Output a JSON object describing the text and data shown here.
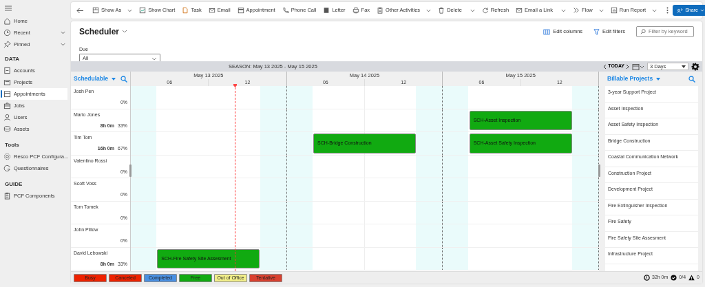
{
  "sidebar": {
    "items": [
      {
        "kind": "link",
        "label": "Home",
        "selected": false
      },
      {
        "kind": "group",
        "label": "Recent",
        "selected": false
      },
      {
        "kind": "group",
        "label": "Pinned",
        "selected": false
      },
      {
        "kind": "heading",
        "label": "DATA"
      },
      {
        "kind": "link",
        "label": "Accounts",
        "selected": false
      },
      {
        "kind": "link",
        "label": "Projects",
        "selected": false
      },
      {
        "kind": "link",
        "label": "Appointments",
        "selected": true
      },
      {
        "kind": "link",
        "label": "Jobs",
        "selected": false
      },
      {
        "kind": "link",
        "label": "Users",
        "selected": false
      },
      {
        "kind": "link",
        "label": "Assets",
        "selected": false
      },
      {
        "kind": "heading",
        "label": "Tools"
      },
      {
        "kind": "link",
        "label": "Resco PCF Configura...",
        "selected": false
      },
      {
        "kind": "link",
        "label": "Questionnaires",
        "selected": false
      },
      {
        "kind": "heading",
        "label": "GUIDE"
      },
      {
        "kind": "link",
        "label": "PCF Components",
        "selected": false
      }
    ]
  },
  "toolbar": {
    "items": [
      {
        "kind": "button",
        "label": "Show As",
        "dropdown": true
      },
      {
        "kind": "button",
        "label": "Show Chart",
        "dropdown": false
      },
      {
        "kind": "button",
        "label": "Task",
        "dropdown": false
      },
      {
        "kind": "button",
        "label": "Email",
        "dropdown": false
      },
      {
        "kind": "button",
        "label": "Appointment",
        "dropdown": false
      },
      {
        "kind": "button",
        "label": "Phone Call",
        "dropdown": false
      },
      {
        "kind": "button",
        "label": "Letter",
        "dropdown": false
      },
      {
        "kind": "button",
        "label": "Fax",
        "dropdown": false
      },
      {
        "kind": "button",
        "label": "Other Activities",
        "dropdown": true
      },
      {
        "kind": "button",
        "label": "Delete",
        "dropdown": false
      },
      {
        "kind": "split"
      },
      {
        "kind": "button",
        "label": "Refresh",
        "dropdown": false
      },
      {
        "kind": "button",
        "label": "Email a Link",
        "dropdown": false
      },
      {
        "kind": "split"
      },
      {
        "kind": "button",
        "label": "Flow",
        "dropdown": true
      },
      {
        "kind": "button",
        "label": "Run Report",
        "dropdown": true
      }
    ],
    "share": "Share"
  },
  "view": {
    "title": "Scheduler",
    "edit_columns": "Edit columns",
    "edit_filters": "Edit filters",
    "search": {
      "placeholder": "Filter by keyword"
    },
    "filter": {
      "label": "Due",
      "value": "All"
    }
  },
  "scheduler": {
    "season": "SEASON: May 13 2025 - May 15 2025",
    "today": "TODAY",
    "range": "3 Days",
    "left_title": "Schedulable",
    "right_title": "Billable Projects",
    "days": [
      {
        "label": "May 13 2025",
        "ticks": [
          "06",
          "12"
        ]
      },
      {
        "label": "May 14 2025",
        "ticks": [
          "06",
          "12"
        ]
      },
      {
        "label": "May 15 2025",
        "ticks": [
          "06",
          "12"
        ]
      }
    ],
    "rows": [
      {
        "name": "Josh Pen",
        "hours": "",
        "percent": "0%",
        "days": [
          {
            "booked": false
          },
          {
            "booked": false
          },
          {
            "booked": false
          }
        ]
      },
      {
        "name": "Mario Jones",
        "hours": "8h 0m",
        "percent": "33%",
        "days": [
          {
            "booked": false
          },
          {
            "booked": false
          },
          {
            "booked": true,
            "title": "SCH-Asset Inspection",
            "color": "#11aa11"
          }
        ]
      },
      {
        "name": "Tim Tom",
        "hours": "16h 0m",
        "percent": "67%",
        "days": [
          {
            "booked": false
          },
          {
            "booked": true,
            "title": "SCH-Bridge Construction",
            "color": "#11aa11"
          },
          {
            "booked": true,
            "title": "SCH-Asset Safety Inspection",
            "color": "#11aa11"
          }
        ]
      },
      {
        "name": "Valentino Rossi",
        "hours": "",
        "percent": "0%",
        "days": [
          {
            "booked": false
          },
          {
            "booked": false
          },
          {
            "booked": false
          }
        ]
      },
      {
        "name": "Scott Voss",
        "hours": "",
        "percent": "0%",
        "days": [
          {
            "booked": false
          },
          {
            "booked": false
          },
          {
            "booked": false
          }
        ]
      },
      {
        "name": "Tom Tomek",
        "hours": "",
        "percent": "0%",
        "days": [
          {
            "booked": false
          },
          {
            "booked": false
          },
          {
            "booked": false
          }
        ]
      },
      {
        "name": "John Pillow",
        "hours": "",
        "percent": "0%",
        "days": [
          {
            "booked": false
          },
          {
            "booked": false
          },
          {
            "booked": false
          }
        ]
      },
      {
        "name": "David Lebowski",
        "hours": "8h 0m",
        "percent": "33%",
        "days": [
          {
            "booked": true,
            "title": "SCH-Fire Safety Site Assesment",
            "color": "#11aa11"
          },
          {
            "booked": false
          },
          {
            "booked": false
          }
        ]
      }
    ],
    "projects": [
      "3-year Support Project",
      "Asset Inspection",
      "Asset Safety Inspection",
      "Bridge Construction",
      "Coastal Communication Network",
      "Construction Project",
      "Development Project",
      "Fire Extinguisher Inspection",
      "Fire Safety",
      "Fire Safety Site Assesment",
      "Infrastructure Project"
    ],
    "legend": [
      {
        "label": "Busy",
        "color": "#ee2200"
      },
      {
        "label": "Canceled",
        "color": "#ee2200"
      },
      {
        "label": "Completed",
        "color": "#4a90e2"
      },
      {
        "label": "Free",
        "color": "#11aa11"
      },
      {
        "label": "Out of Office",
        "color": "#f3f08a"
      },
      {
        "label": "Tentative",
        "color": "#d9402f"
      }
    ],
    "status": {
      "duration": "32h 0m",
      "done": "0/4",
      "warnings": "0"
    }
  }
}
